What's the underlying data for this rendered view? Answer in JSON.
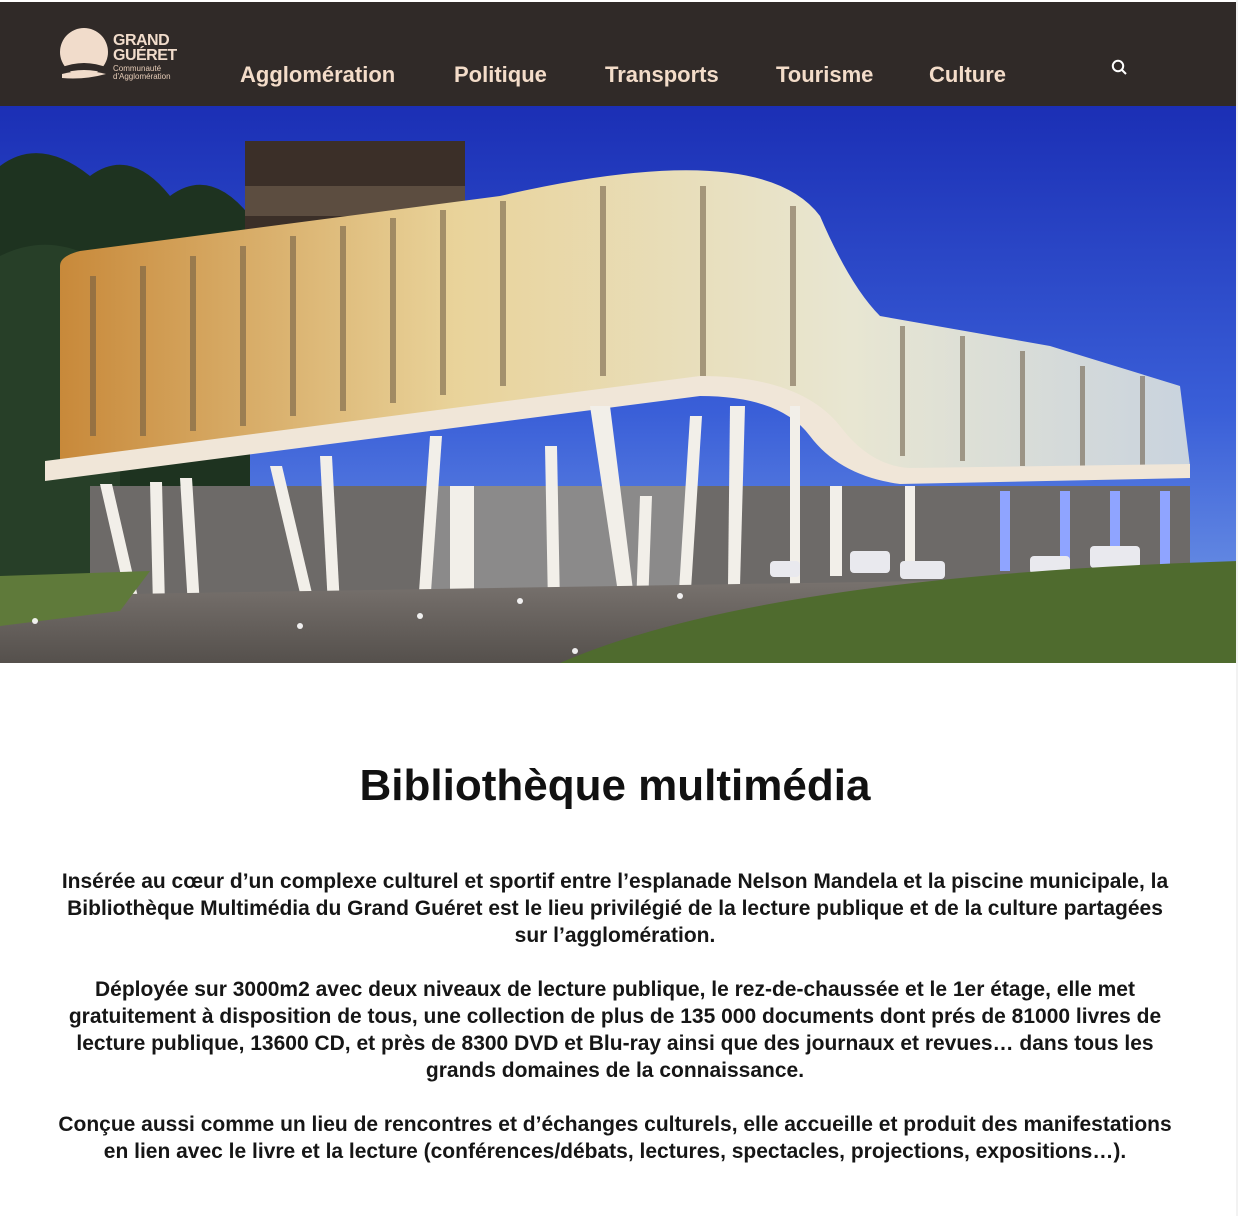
{
  "header": {
    "logo": {
      "line1": "GRAND",
      "line2": "GUÉRET",
      "subtitle": "Communauté d'Agglomération"
    },
    "nav": [
      {
        "label": "Agglomération"
      },
      {
        "label": "Politique"
      },
      {
        "label": "Transports"
      },
      {
        "label": "Tourisme"
      },
      {
        "label": "Culture"
      }
    ],
    "search_icon": "search-icon",
    "colors": {
      "bar": "#302a28",
      "nav_text": "#f3dcc9"
    }
  },
  "hero": {
    "image": "library-building-night-photo"
  },
  "main": {
    "title": "Bibliothèque multimédia",
    "paragraphs": [
      "Insérée au cœur d’un complexe culturel et sportif entre l’esplanade Nelson Mandela et la piscine municipale, la Bibliothèque Multimédia du Grand Guéret est le lieu privilégié de la lecture publique et de la culture partagées sur l’agglomération.",
      "Déployée sur 3000m2 avec deux niveaux de lecture publique, le rez-de-chaussée et le 1er étage, elle met gratuitement à disposition de tous, une collection de plus de 135 000 documents dont prés de 81000 livres de lecture publique, 13600 CD, et près de 8300 DVD et Blu-ray ainsi que des journaux et revues… dans tous les grands domaines de la connaissance.",
      "Conçue aussi comme un lieu de rencontres et d’échanges culturels, elle accueille et produit des manifestations en lien avec le livre et la lecture (conférences/débats, lectures, spectacles, projections, expositions…)."
    ]
  }
}
